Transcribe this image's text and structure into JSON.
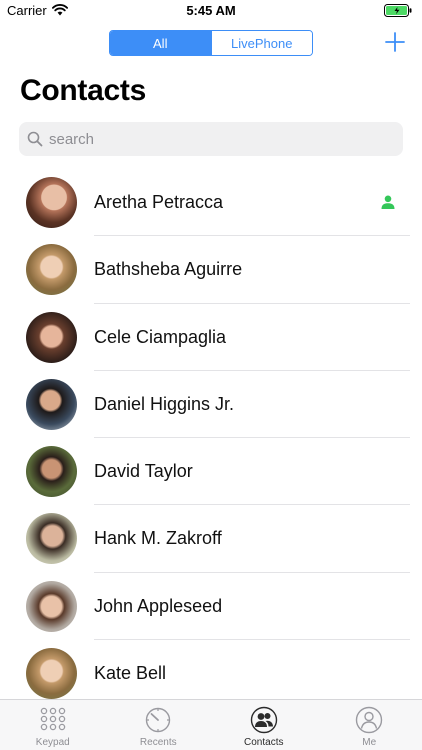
{
  "status_bar": {
    "carrier": "Carrier",
    "time": "5:45 AM",
    "battery_color": "#4cd964"
  },
  "header": {
    "segments": [
      "All",
      "LivePhone"
    ],
    "selected_segment": "All",
    "title": "Contacts",
    "accent_color": "#3d8ef7",
    "add_icon": "plus-icon"
  },
  "search": {
    "placeholder": "search",
    "value": ""
  },
  "contacts": [
    {
      "name": "Aretha Petracca",
      "is_me": true
    },
    {
      "name": "Bathsheba Aguirre"
    },
    {
      "name": "Cele Ciampaglia"
    },
    {
      "name": "Daniel Higgins Jr."
    },
    {
      "name": "David Taylor"
    },
    {
      "name": "Hank M. Zakroff"
    },
    {
      "name": "John Appleseed"
    },
    {
      "name": "Kate Bell"
    }
  ],
  "me_badge_color": "#34c759",
  "tab_bar": {
    "tabs": [
      {
        "label": "Keypad",
        "icon": "keypad-icon"
      },
      {
        "label": "Recents",
        "icon": "recents-icon"
      },
      {
        "label": "Contacts",
        "icon": "contacts-icon"
      },
      {
        "label": "Me",
        "icon": "me-icon"
      }
    ],
    "selected": "Contacts"
  }
}
